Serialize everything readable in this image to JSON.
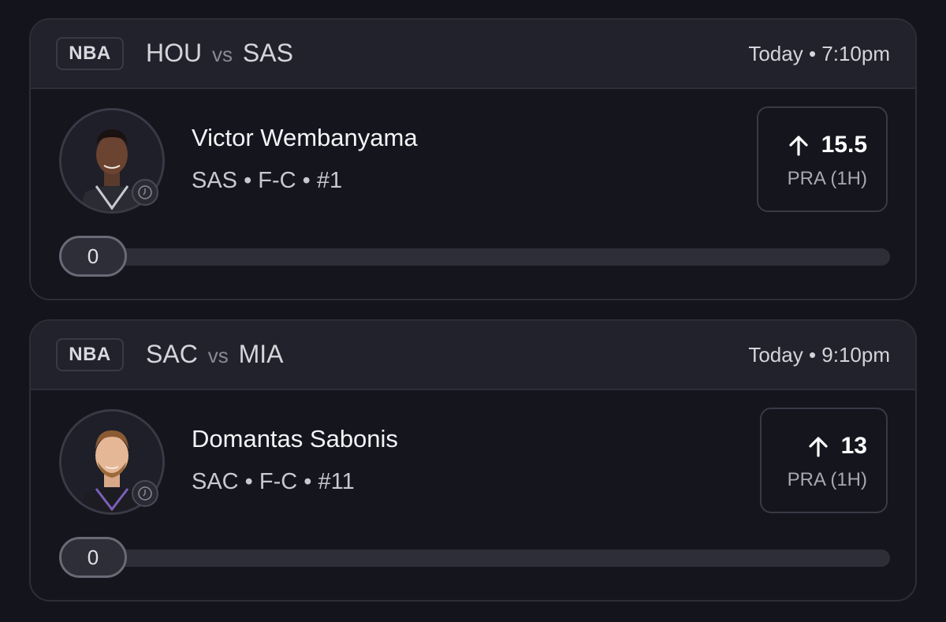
{
  "cards": [
    {
      "league": "NBA",
      "home_team": "HOU",
      "vs": "vs",
      "away_team": "SAS",
      "game_time": "Today • 7:10pm",
      "player_name": "Victor Wembanyama",
      "player_meta": "SAS • F-C • #1",
      "line_value": "15.5",
      "stat_label": "PRA (1H)",
      "direction_icon": "arrow-up-icon",
      "progress_value": "0",
      "progress_fraction": 0,
      "jersey_color": "#2b2b33",
      "jersey_trim": "#c9c9d2"
    },
    {
      "league": "NBA",
      "home_team": "SAC",
      "vs": "vs",
      "away_team": "MIA",
      "game_time": "Today • 9:10pm",
      "player_name": "Domantas Sabonis",
      "player_meta": "SAC • F-C • #11",
      "line_value": "13",
      "stat_label": "PRA (1H)",
      "direction_icon": "arrow-up-icon",
      "progress_value": "0",
      "progress_fraction": 0,
      "jersey_color": "#1c1c22",
      "jersey_trim": "#7b5fb8"
    }
  ],
  "colors": {
    "background": "#14141c",
    "card_header": "#22222c",
    "card_border": "#2e2e38",
    "progress_track": "#2e2e38"
  }
}
